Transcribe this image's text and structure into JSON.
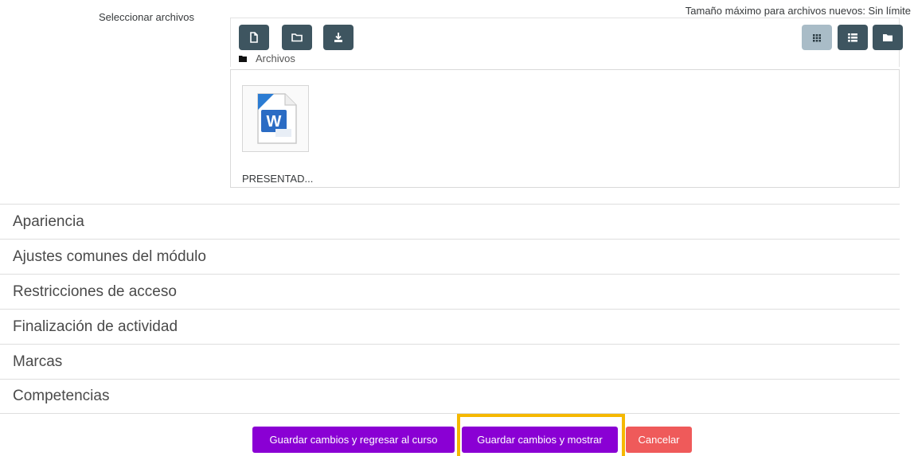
{
  "files": {
    "select_label": "Seleccionar archivos",
    "max_size": "Tamaño máximo para archivos nuevos: Sin límite",
    "breadcrumb": "Archivos",
    "items": [
      {
        "name": "PRESENTAD...",
        "icon": "word-document-icon"
      }
    ],
    "toolbar_left": [
      "add-file-icon",
      "create-folder-icon",
      "download-icon"
    ],
    "toolbar_right": [
      "icons-view-icon",
      "list-view-icon",
      "tree-view-icon"
    ]
  },
  "sections": [
    "Apariencia",
    "Ajustes comunes del módulo",
    "Restricciones de acceso",
    "Finalización de actividad",
    "Marcas",
    "Competencias"
  ],
  "buttons": {
    "save_return": "Guardar cambios y regresar al curso",
    "save_show": "Guardar cambios y mostrar",
    "cancel": "Cancelar"
  },
  "colors": {
    "primary": "#8a00d4",
    "danger": "#ef5a5a",
    "toolbar_button": "#3e5560",
    "toolbar_active": "#a9bcc7",
    "highlight": "#f5b800"
  }
}
